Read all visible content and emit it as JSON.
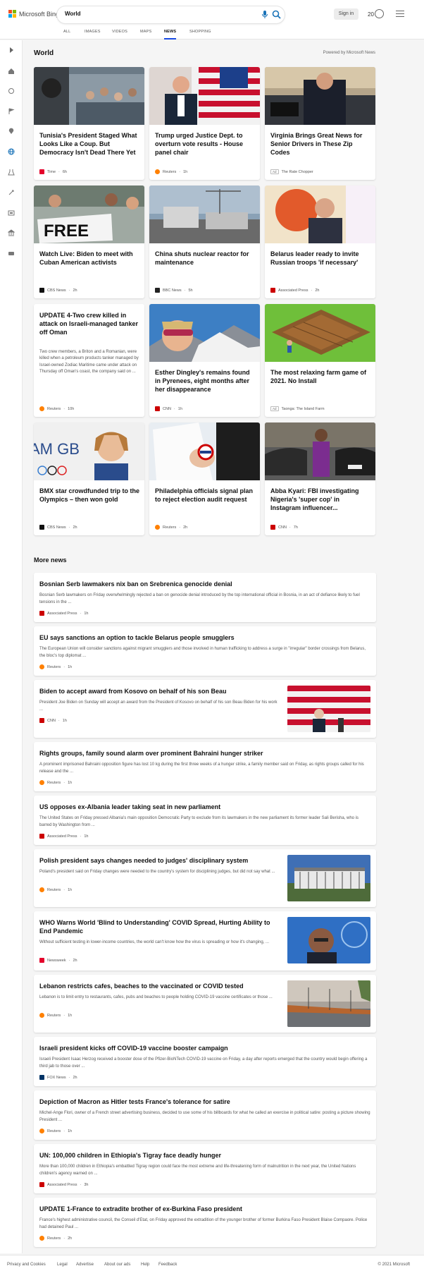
{
  "header": {
    "brand": "Microsoft Bing",
    "query": "World",
    "signin": "Sign in",
    "rewards": "20"
  },
  "tabs": [
    "ALL",
    "IMAGES",
    "VIDEOS",
    "MAPS",
    "NEWS",
    "SHOPPING"
  ],
  "active_tab": "NEWS",
  "section": {
    "title": "World",
    "powered": "Powered by Microsoft News"
  },
  "cards": [
    {
      "title": "Tunisia's President Staged What Looks Like a Coup. But Democracy Isn't Dead There Yet",
      "summary": "",
      "source": "Time",
      "time": "6h",
      "ad": false,
      "logo_color": "#e4002b"
    },
    {
      "title": "Trump urged Justice Dept. to overturn vote results - House panel chair",
      "summary": "",
      "source": "Reuters",
      "time": "1h",
      "ad": false,
      "logo_color": "#ff8000"
    },
    {
      "title": "Virginia Brings Great News for Senior Drivers in These Zip Codes",
      "summary": "",
      "source": "The Rate Chopper",
      "time": "",
      "ad": true,
      "logo_color": ""
    },
    {
      "title": "Watch Live: Biden to meet with Cuban American activists",
      "summary": "",
      "source": "CBS News",
      "time": "2h",
      "ad": false,
      "logo_color": "#111111"
    },
    {
      "title": "China shuts nuclear reactor for maintenance",
      "summary": "",
      "source": "BBC News",
      "time": "5h",
      "ad": false,
      "logo_color": "#222222"
    },
    {
      "title": "Belarus leader ready to invite Russian troops 'if necessary'",
      "summary": "",
      "source": "Associated Press",
      "time": "2h",
      "ad": false,
      "logo_color": "#cc0000"
    },
    {
      "title": "UPDATE 4-Two crew killed in attack on Israeli-managed tanker off Oman",
      "summary": "Two crew members, a Briton and a Romanian, were killed when a petroleum products tanker managed by Israel-owned Zodiac Maritime came under attack on Thursday off Oman's coast, the company said on ...",
      "source": "Reuters",
      "time": "10h",
      "ad": false,
      "logo_color": "#ff8000"
    },
    {
      "title": "Esther Dingley's remains found in Pyrenees, eight months after her disappearance",
      "summary": "",
      "source": "CNN",
      "time": "1h",
      "ad": false,
      "logo_color": "#cc0000"
    },
    {
      "title": "The most relaxing farm game of 2021. No Install",
      "summary": "",
      "source": "Taonga: The Island Farm",
      "time": "",
      "ad": true,
      "logo_color": ""
    },
    {
      "title": "BMX star crowdfunded trip to the Olympics – then won gold",
      "summary": "",
      "source": "CBS News",
      "time": "2h",
      "ad": false,
      "logo_color": "#111111"
    },
    {
      "title": "Philadelphia officials signal plan to reject election audit request",
      "summary": "",
      "source": "Reuters",
      "time": "2h",
      "ad": false,
      "logo_color": "#ff8000"
    },
    {
      "title": "Abba Kyari: FBI investigating Nigeria's 'super cop' in Instagram influencer...",
      "summary": "",
      "source": "CNN",
      "time": "7h",
      "ad": false,
      "logo_color": "#cc0000"
    }
  ],
  "more_news_title": "More news",
  "more_news": [
    {
      "title": "Bosnian Serb lawmakers nix ban on Srebrenica genocide denial",
      "summary": "Bosnian Serb lawmakers on Friday overwhelmingly rejected a ban on genocide denial introduced by the top international official in Bosnia, in an act of defiance likely to fuel tensions in the ...",
      "source": "Associated Press",
      "time": "1h",
      "logo_color": "#cc0000",
      "image": false
    },
    {
      "title": "EU says sanctions an option to tackle Belarus people smugglers",
      "summary": "The European Union will consider sanctions against migrant smugglers and those involved in human trafficking to address a surge in \"irregular\" border crossings from Belarus, the bloc's top diplomat ...",
      "source": "Reuters",
      "time": "1h",
      "logo_color": "#ff8000",
      "image": false
    },
    {
      "title": "Biden to accept award from Kosovo on behalf of his son Beau",
      "summary": "President Joe Biden on Sunday will accept an award from the President of Kosovo on behalf of his son Beau Biden for his work ...",
      "source": "CNN",
      "time": "1h",
      "logo_color": "#cc0000",
      "image": true
    },
    {
      "title": "Rights groups, family sound alarm over prominent Bahraini hunger striker",
      "summary": "A prominent imprisoned Bahraini opposition figure has lost 10 kg during the first three weeks of a hunger strike, a family member said on Friday, as rights groups called for his release and the ...",
      "source": "Reuters",
      "time": "1h",
      "logo_color": "#ff8000",
      "image": false
    },
    {
      "title": "US opposes ex-Albania leader taking seat in new parliament",
      "summary": "The United States on Friday pressed Albania's main opposition Democratic Party to exclude from its lawmakers in the new parliament its former leader Sali Berisha, who is barred by Washington from ...",
      "source": "Associated Press",
      "time": "1h",
      "logo_color": "#cc0000",
      "image": false
    },
    {
      "title": "Polish president says changes needed to judges' disciplinary system",
      "summary": "Poland's president said on Friday changes were needed to the country's system for disciplining judges, but did not say what ...",
      "source": "Reuters",
      "time": "1h",
      "logo_color": "#ff8000",
      "image": true
    },
    {
      "title": "WHO Warns World 'Blind to Understanding' COVID Spread, Hurting Ability to End Pandemic",
      "summary": "Without sufficient testing in lower-income countries, the world can't know how the virus is spreading or how it's changing, ...",
      "source": "Newsweek",
      "time": "2h",
      "logo_color": "#e4002b",
      "image": true
    },
    {
      "title": "Lebanon restricts cafes, beaches to the vaccinated or COVID tested",
      "summary": "Lebanon is to limit entry to restaurants, cafes, pubs and beaches to people holding COVID-19 vaccine certificates or those ...",
      "source": "Reuters",
      "time": "1h",
      "logo_color": "#ff8000",
      "image": true
    },
    {
      "title": "Israeli president kicks off COVID-19 vaccine booster campaign",
      "summary": "Israeli President Isaac Herzog received a booster dose of the Pfizer-BioNTech COVID-19 vaccine on Friday, a day after reports emerged that the country would begin offering a third jab to those over ...",
      "source": "FOX News",
      "time": "2h",
      "logo_color": "#003366",
      "image": false
    },
    {
      "title": "Depiction of Macron as Hitler tests France's tolerance for satire",
      "summary": "Michel-Ange Flori, owner of a French street advertising business, decided to use some of his billboards for what he called an exercise in political satire: posting a picture showing President ...",
      "source": "Reuters",
      "time": "1h",
      "logo_color": "#ff8000",
      "image": false
    },
    {
      "title": "UN: 100,000 children in Ethiopia's Tigray face deadly hunger",
      "summary": "More than 100,000 children in Ethiopia's embattled Tigray region could face the most extreme and life-threatening form of malnutrition in the next year, the United Nations children's agency warned on ...",
      "source": "Associated Press",
      "time": "3h",
      "logo_color": "#cc0000",
      "image": false
    },
    {
      "title": "UPDATE 1-France to extradite brother of ex-Burkina Faso president",
      "summary": "France's highest administrative council, the Conseil d'Etat, on Friday approved the extradition of the younger brother of former Burkina Faso President Blaise Compaore. Police had detained Paul ...",
      "source": "Reuters",
      "time": "2h",
      "logo_color": "#ff8000",
      "image": false
    }
  ],
  "footer": {
    "links": [
      "Privacy and Cookies",
      "Legal",
      "Advertise",
      "About our ads",
      "Help",
      "Feedback"
    ],
    "copyright": "© 2021 Microsoft"
  }
}
